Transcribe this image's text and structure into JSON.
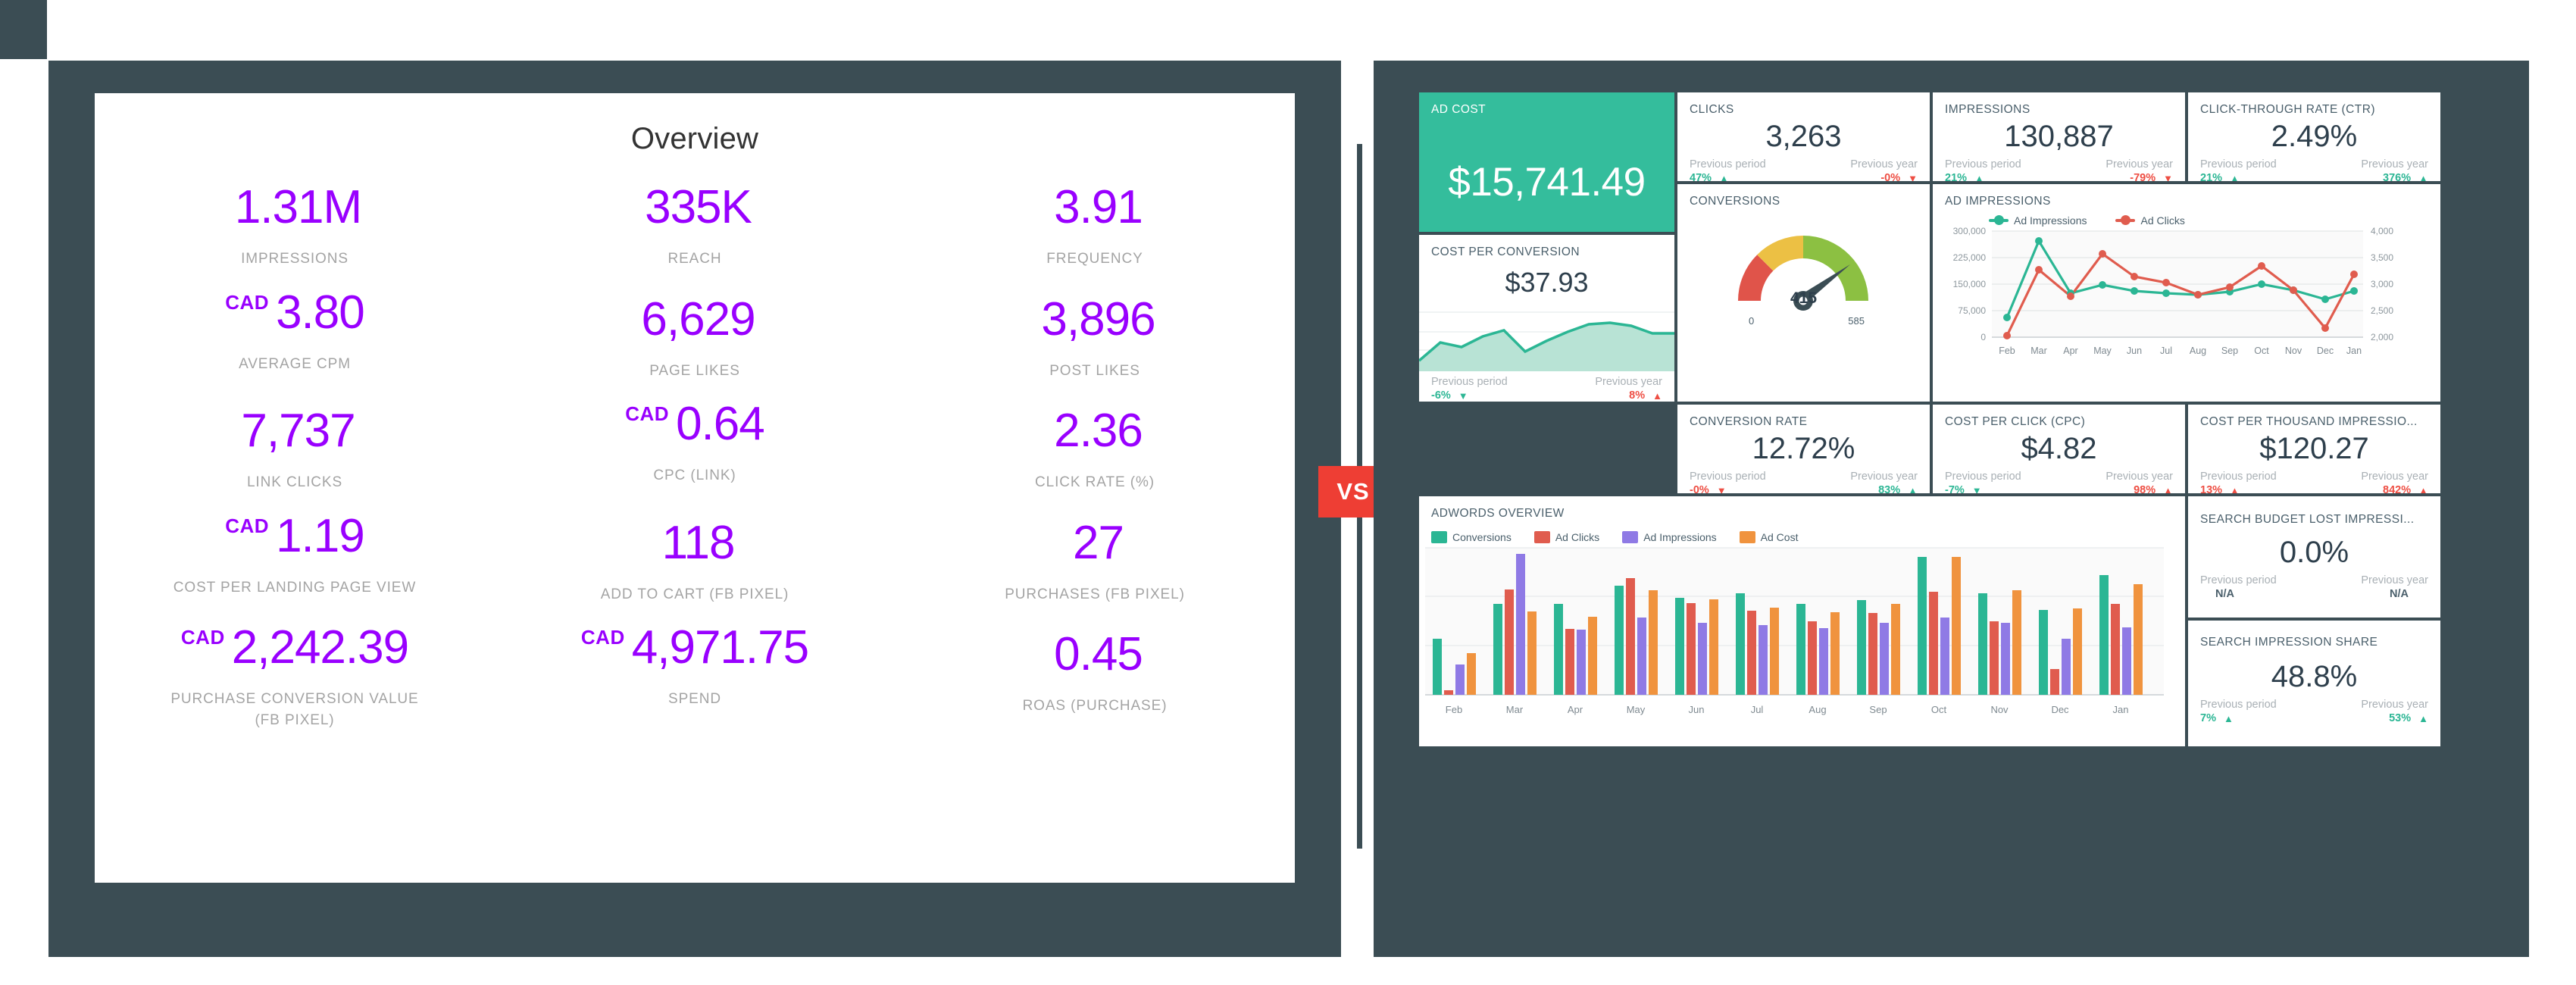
{
  "left": {
    "title": "Overview",
    "metrics": [
      {
        "currency": "",
        "value": "1.31M",
        "label": "IMPRESSIONS"
      },
      {
        "currency": "",
        "value": "335K",
        "label": "REACH"
      },
      {
        "currency": "",
        "value": "3.91",
        "label": "FREQUENCY"
      },
      {
        "currency": "CAD",
        "value": "3.80",
        "label": "AVERAGE CPM"
      },
      {
        "currency": "",
        "value": "6,629",
        "label": "PAGE LIKES"
      },
      {
        "currency": "",
        "value": "3,896",
        "label": "POST LIKES"
      },
      {
        "currency": "",
        "value": "7,737",
        "label": "LINK CLICKS"
      },
      {
        "currency": "CAD",
        "value": "0.64",
        "label": "CPC (LINK)"
      },
      {
        "currency": "",
        "value": "2.36",
        "label": "CLICK RATE (%)"
      },
      {
        "currency": "CAD",
        "value": "1.19",
        "label": "COST PER LANDING PAGE VIEW"
      },
      {
        "currency": "",
        "value": "118",
        "label": "ADD TO CART (FB PIXEL)"
      },
      {
        "currency": "",
        "value": "27",
        "label": "PURCHASES (FB PIXEL)"
      },
      {
        "currency": "CAD",
        "value": "2,242.39",
        "label": "PURCHASE CONVERSION VALUE (FB PIXEL)"
      },
      {
        "currency": "CAD",
        "value": "4,971.75",
        "label": "SPEND"
      },
      {
        "currency": "",
        "value": "0.45",
        "label": "ROAS (PURCHASE)"
      }
    ]
  },
  "divider": {
    "badge": "VS"
  },
  "right": {
    "ad_cost": {
      "title": "AD COST",
      "value": "$15,741.49"
    },
    "cost_per_conversion": {
      "title": "COST PER CONVERSION",
      "value": "$37.93",
      "prev_period_label": "Previous period",
      "prev_year_label": "Previous year",
      "prev_period_value": "-6%",
      "prev_year_value": "8%",
      "prev_period_dir": "down",
      "prev_year_dir": "up",
      "prev_period_tone": "pos",
      "prev_year_tone": "neg"
    },
    "clicks": {
      "title": "CLICKS",
      "value": "3,263",
      "prev_period_label": "Previous period",
      "prev_year_label": "Previous year",
      "prev_period_value": "47%",
      "prev_year_value": "-0%",
      "prev_period_dir": "up",
      "prev_year_dir": "down",
      "prev_period_tone": "pos",
      "prev_year_tone": "neg"
    },
    "impressions": {
      "title": "IMPRESSIONS",
      "value": "130,887",
      "prev_period_label": "Previous period",
      "prev_year_label": "Previous year",
      "prev_period_value": "21%",
      "prev_year_value": "-79%",
      "prev_period_dir": "up",
      "prev_year_dir": "down",
      "prev_period_tone": "pos",
      "prev_year_tone": "neg"
    },
    "ctr": {
      "title": "CLICK-THROUGH RATE (CTR)",
      "value": "2.49%",
      "prev_period_label": "Previous period",
      "prev_year_label": "Previous year",
      "prev_period_value": "21%",
      "prev_year_value": "376%",
      "prev_period_dir": "up",
      "prev_year_dir": "up",
      "prev_period_tone": "pos",
      "prev_year_tone": "pos"
    },
    "conversions": {
      "title": "CONVERSIONS",
      "value": "415",
      "min": "0",
      "max": "585"
    },
    "conversion_rate": {
      "title": "CONVERSION RATE",
      "value": "12.72%",
      "prev_period_label": "Previous period",
      "prev_year_label": "Previous year",
      "prev_period_value": "-0%",
      "prev_year_value": "83%",
      "prev_period_dir": "down",
      "prev_year_dir": "up",
      "prev_period_tone": "neg",
      "prev_year_tone": "pos"
    },
    "cpc": {
      "title": "COST PER CLICK (CPC)",
      "value": "$4.82",
      "prev_period_label": "Previous period",
      "prev_year_label": "Previous year",
      "prev_period_value": "-7%",
      "prev_year_value": "98%",
      "prev_period_dir": "down",
      "prev_year_dir": "up",
      "prev_period_tone": "pos",
      "prev_year_tone": "neg"
    },
    "cpm": {
      "title": "COST PER THOUSAND IMPRESSIO...",
      "value": "$120.27",
      "prev_period_label": "Previous period",
      "prev_year_label": "Previous year",
      "prev_period_value": "13%",
      "prev_year_value": "842%",
      "prev_period_dir": "up",
      "prev_year_dir": "up",
      "prev_period_tone": "neg",
      "prev_year_tone": "neg"
    },
    "budget_lost": {
      "title": "SEARCH BUDGET LOST IMPRESSI...",
      "value": "0.0%",
      "prev_period_label": "Previous period",
      "prev_year_label": "Previous year",
      "prev_period_value": "N/A",
      "prev_year_value": "N/A"
    },
    "impression_share": {
      "title": "SEARCH IMPRESSION SHARE",
      "value": "48.8%",
      "prev_period_label": "Previous period",
      "prev_year_label": "Previous year",
      "prev_period_value": "7%",
      "prev_year_value": "53%",
      "prev_period_dir": "up",
      "prev_year_dir": "up",
      "prev_period_tone": "pos",
      "prev_year_tone": "pos"
    },
    "ad_impressions_chart": {
      "title": "AD IMPRESSIONS"
    },
    "adwords_chart": {
      "title": "ADWORDS OVERVIEW"
    }
  },
  "chart_data": [
    {
      "type": "line",
      "title": "AD IMPRESSIONS",
      "x": [
        "Feb",
        "Mar",
        "Apr",
        "May",
        "Jun",
        "Jul",
        "Aug",
        "Sep",
        "Oct",
        "Nov",
        "Dec",
        "Jan"
      ],
      "series": [
        {
          "name": "Ad Impressions",
          "color": "#2bb694",
          "axis": "left",
          "values": [
            55000,
            275000,
            125000,
            148000,
            131000,
            127000,
            121000,
            130000,
            149000,
            133000,
            108000,
            131000
          ]
        },
        {
          "name": "Ad Clicks",
          "color": "#e05c4e",
          "axis": "right",
          "values": [
            2040,
            3400,
            2880,
            3700,
            3280,
            3130,
            2950,
            3010,
            3480,
            2940,
            2240,
            3290
          ]
        }
      ],
      "ylabel": "",
      "xlabel": "",
      "ylim": [
        0,
        300000
      ],
      "yticks_left": [
        "0",
        "75,000",
        "150,000",
        "225,000",
        "300,000"
      ],
      "ylim_right": [
        2000,
        4000
      ],
      "yticks_right": [
        "2,000",
        "2,500",
        "3,000",
        "3,500",
        "4,000"
      ],
      "grid": true,
      "legend": "top"
    },
    {
      "type": "bar",
      "title": "ADWORDS OVERVIEW",
      "categories": [
        "Feb",
        "Mar",
        "Apr",
        "May",
        "Jun",
        "Jul",
        "Aug",
        "Sep",
        "Oct",
        "Nov",
        "Dec",
        "Jan"
      ],
      "series": [
        {
          "name": "Conversions",
          "color": "#2bb694",
          "values": [
            35,
            57,
            57,
            80,
            64,
            69,
            57,
            62,
            90,
            69,
            52,
            84
          ]
        },
        {
          "name": "Ad Clicks",
          "color": "#e05c4e",
          "values": [
            3,
            66,
            41,
            84,
            56,
            49,
            43,
            47,
            70,
            41,
            11,
            56
          ]
        },
        {
          "name": "Ad Impressions",
          "color": "#8f7ae5",
          "values": [
            19,
            100,
            41,
            53,
            42,
            40,
            37,
            41,
            53,
            40,
            31,
            41
          ]
        },
        {
          "name": "Ad Cost",
          "color": "#f0933e",
          "values": [
            26,
            52,
            49,
            76,
            63,
            58,
            52,
            58,
            90,
            68,
            54,
            78
          ]
        }
      ],
      "ylim": [
        0,
        100
      ],
      "grid": true,
      "legend": "top"
    },
    {
      "type": "gauge",
      "title": "CONVERSIONS",
      "value": 415,
      "min": 0,
      "max": 585,
      "bands": [
        {
          "color": "#e0544a",
          "from": 0,
          "to": 0.22
        },
        {
          "color": "#ecc044",
          "from": 0.22,
          "to": 0.44
        },
        {
          "color": "#8cc042",
          "from": 0.44,
          "to": 1.0
        }
      ]
    },
    {
      "type": "area",
      "title": "COST PER CONVERSION sparkline",
      "color": "#2bb694",
      "values": [
        18,
        47,
        40,
        55,
        62,
        30,
        44,
        58,
        70,
        73,
        69,
        58
      ]
    }
  ]
}
